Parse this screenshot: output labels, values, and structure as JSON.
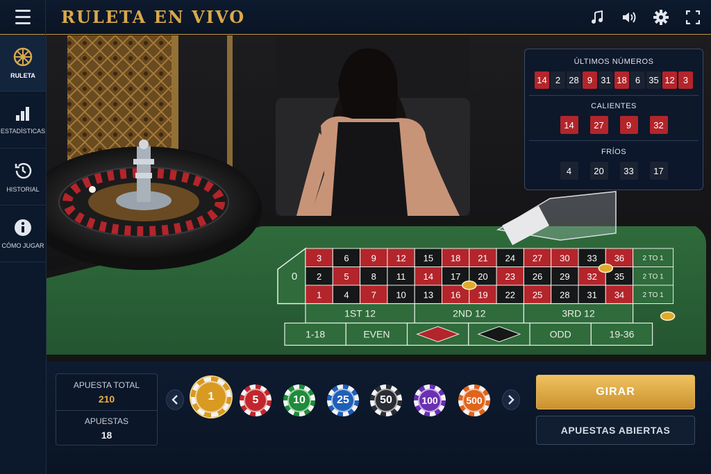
{
  "header": {
    "title": "RULETA EN VIVO"
  },
  "top_icons": [
    "music-icon",
    "volume-icon",
    "gear-icon",
    "fullscreen-icon"
  ],
  "sidebar": {
    "items": [
      {
        "label": "RULETA",
        "icon": "roulette-icon",
        "active": true
      },
      {
        "label": "ESTADÍSTICAS",
        "icon": "bar-chart-icon",
        "active": false
      },
      {
        "label": "HISTORIAL",
        "icon": "history-icon",
        "active": false
      },
      {
        "label": "CÓMO JUGAR",
        "icon": "info-icon",
        "active": false
      }
    ]
  },
  "stats": {
    "last_title": "ÚLTIMOS NÚMEROS",
    "last": [
      {
        "n": "14",
        "c": "red"
      },
      {
        "n": "2",
        "c": "black"
      },
      {
        "n": "28",
        "c": "black"
      },
      {
        "n": "9",
        "c": "red"
      },
      {
        "n": "31",
        "c": "black"
      },
      {
        "n": "18",
        "c": "red"
      },
      {
        "n": "6",
        "c": "black"
      },
      {
        "n": "35",
        "c": "black"
      },
      {
        "n": "12",
        "c": "red"
      },
      {
        "n": "3",
        "c": "red"
      }
    ],
    "hot_title": "CALIENTES",
    "hot": [
      "14",
      "27",
      "9",
      "32"
    ],
    "cold_title": "FRÍOS",
    "cold": [
      "4",
      "20",
      "33",
      "17"
    ]
  },
  "table": {
    "zero": "0",
    "rows": [
      [
        "3",
        "6",
        "9",
        "12",
        "15",
        "18",
        "21",
        "24",
        "27",
        "30",
        "33",
        "36"
      ],
      [
        "2",
        "5",
        "8",
        "11",
        "14",
        "17",
        "20",
        "23",
        "26",
        "29",
        "32",
        "35"
      ],
      [
        "1",
        "4",
        "7",
        "10",
        "13",
        "16",
        "19",
        "22",
        "25",
        "28",
        "31",
        "34"
      ]
    ],
    "reds": [
      "1",
      "3",
      "5",
      "7",
      "9",
      "12",
      "14",
      "16",
      "18",
      "19",
      "21",
      "23",
      "25",
      "27",
      "30",
      "32",
      "34",
      "36"
    ],
    "column_bets": [
      "2 TO 1",
      "2 TO 1",
      "2 TO 1"
    ],
    "dozens": [
      "1ST 12",
      "2ND 12",
      "3RD 12"
    ],
    "outside": [
      "1-18",
      "EVEN",
      "red-diamond",
      "black-diamond",
      "ODD",
      "19-36"
    ]
  },
  "bet": {
    "total_label": "APUESTA TOTAL",
    "total_value": "210",
    "bets_label": "APUESTAS",
    "bets_value": "18"
  },
  "chips": [
    {
      "value": "1",
      "color": "#d99a22"
    },
    {
      "value": "5",
      "color": "#c2262d"
    },
    {
      "value": "10",
      "color": "#1e8c3a"
    },
    {
      "value": "25",
      "color": "#1f5fb8"
    },
    {
      "value": "50",
      "color": "#2a2d33"
    },
    {
      "value": "100",
      "color": "#6b2fb3"
    },
    {
      "value": "500",
      "color": "#e0641c"
    }
  ],
  "buttons": {
    "spin": "GIRAR",
    "open_bets": "APUESTAS ABIERTAS"
  },
  "colors": {
    "accent": "#d9a94a",
    "red": "#b3252b",
    "felt": "#2e6a3a"
  }
}
